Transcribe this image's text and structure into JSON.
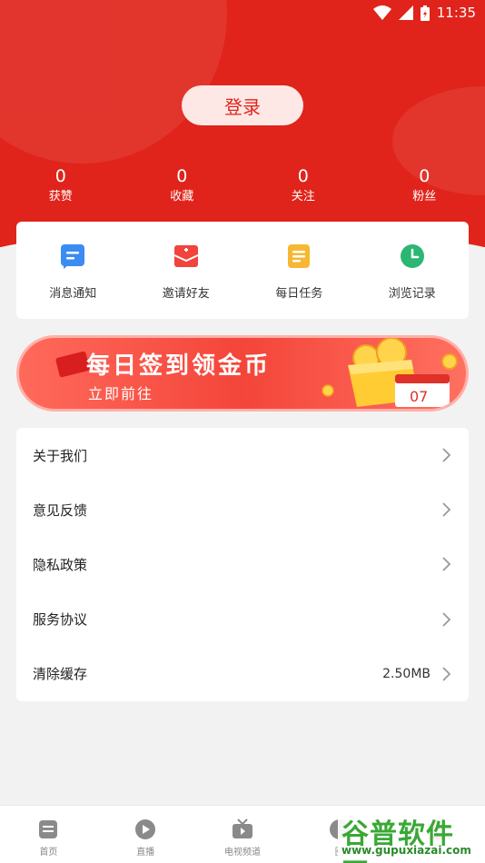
{
  "status_bar": {
    "time": "11:35"
  },
  "header": {
    "login_label": "登录",
    "stats": [
      {
        "value": "0",
        "label": "获赞"
      },
      {
        "value": "0",
        "label": "收藏"
      },
      {
        "value": "0",
        "label": "关注"
      },
      {
        "value": "0",
        "label": "粉丝"
      }
    ]
  },
  "quick_actions": [
    {
      "label": "消息通知",
      "icon": "message-icon",
      "color": "#3b8cf2"
    },
    {
      "label": "邀请好友",
      "icon": "invite-envelope-icon",
      "color": "#f2433c"
    },
    {
      "label": "每日任务",
      "icon": "task-list-icon",
      "color": "#f7b733"
    },
    {
      "label": "浏览记录",
      "icon": "clock-icon",
      "color": "#2bb673"
    }
  ],
  "banner": {
    "title": "每日签到领金币",
    "subtitle": "立即前往",
    "calendar_day": "07"
  },
  "menu": [
    {
      "label": "关于我们",
      "value": ""
    },
    {
      "label": "意见反馈",
      "value": ""
    },
    {
      "label": "隐私政策",
      "value": ""
    },
    {
      "label": "服务协议",
      "value": ""
    },
    {
      "label": "清除缓存",
      "value": "2.50MB"
    }
  ],
  "bottom_nav": [
    {
      "label": "首页",
      "icon": "home-icon"
    },
    {
      "label": "直播",
      "icon": "play-icon"
    },
    {
      "label": "电视频道",
      "icon": "tv-icon"
    },
    {
      "label": "圈",
      "icon": "circle-icon"
    },
    {
      "label": "",
      "icon": "profile-icon"
    }
  ],
  "watermark": {
    "brand": "谷普软件园",
    "url": "www.gupuxiazai.com"
  },
  "colors": {
    "primary": "#e0241b",
    "background": "#f2f2f2"
  }
}
